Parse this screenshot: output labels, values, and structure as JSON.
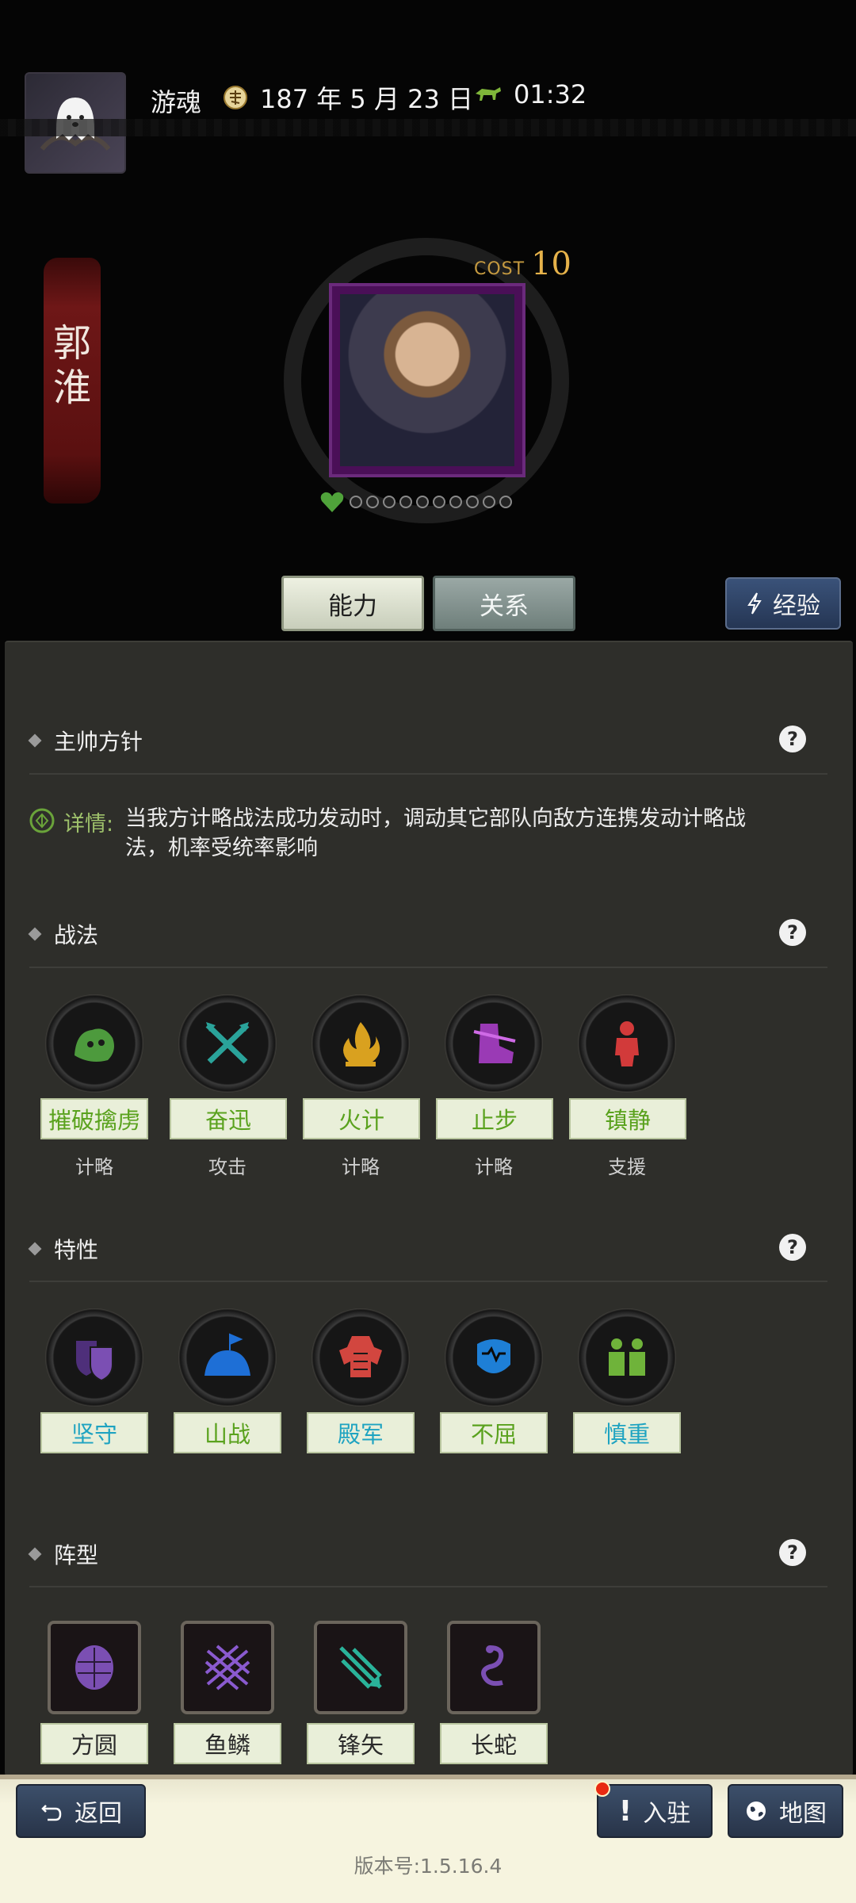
{
  "player": {
    "name": "游魂",
    "date": "187 年 5 月 23 日",
    "time": "01:32"
  },
  "general": {
    "name_line1": "郭",
    "name_line2": "淮",
    "cost_label": "COST",
    "cost_value": "10",
    "star_count": 10,
    "stars_filled": 0
  },
  "tabs": [
    {
      "label": "能力",
      "active": true
    },
    {
      "label": "关系",
      "active": false
    }
  ],
  "exp_button": {
    "label": "经验"
  },
  "sections": {
    "commander": {
      "title": "主帅方针",
      "detail_label": "详情:",
      "detail_text": "当我方计略战法成功发动时，调动其它部队向敌方连携发动计略战法，机率受统率影响"
    },
    "tactics": {
      "title": "战法",
      "items": [
        {
          "name": "摧破擒虏",
          "category": "计略",
          "icon": "goblin-icon",
          "color": "#4d9a3d"
        },
        {
          "name": "奋迅",
          "category": "攻击",
          "icon": "crossed-swords-icon",
          "color": "#2aa39a"
        },
        {
          "name": "火计",
          "category": "计略",
          "icon": "fire-icon",
          "color": "#d9a11f"
        },
        {
          "name": "止步",
          "category": "计略",
          "icon": "boot-icon",
          "color": "#9a3ab5"
        },
        {
          "name": "镇静",
          "category": "支援",
          "icon": "figure-icon",
          "color": "#d23a3a"
        }
      ]
    },
    "traits": {
      "title": "特性",
      "items": [
        {
          "name": "坚守",
          "icon": "shields-icon",
          "color": "#7b4fb3"
        },
        {
          "name": "山战",
          "icon": "mountain-flag-icon",
          "color": "#1e6fd6"
        },
        {
          "name": "殿军",
          "icon": "armor-icon",
          "color": "#d2463f"
        },
        {
          "name": "不屈",
          "icon": "mask-icon",
          "color": "#1e7fd6"
        },
        {
          "name": "慎重",
          "icon": "two-figures-icon",
          "color": "#6fb33a"
        }
      ]
    },
    "formations": {
      "title": "阵型",
      "items": [
        {
          "name": "方圆",
          "icon": "turtle-shell-icon",
          "color": "#7b4fb3"
        },
        {
          "name": "鱼鳞",
          "icon": "scales-icon",
          "color": "#8a5acf"
        },
        {
          "name": "锋矢",
          "icon": "arrowhead-icon",
          "color": "#2ab39a"
        },
        {
          "name": "长蛇",
          "icon": "snake-icon",
          "color": "#7b4fb3"
        }
      ]
    }
  },
  "bottom": {
    "back_label": "返回",
    "station_label": "入驻",
    "map_label": "地图",
    "version": "版本号:1.5.16.4"
  }
}
